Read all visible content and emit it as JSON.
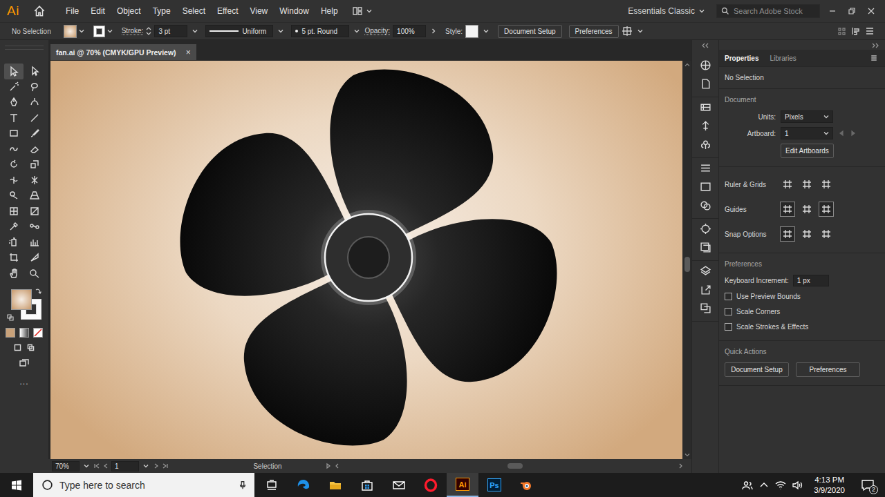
{
  "menu_bar": {
    "logo": "Ai",
    "items": [
      "File",
      "Edit",
      "Object",
      "Type",
      "Select",
      "Effect",
      "View",
      "Window",
      "Help"
    ],
    "workspace": "Essentials Classic",
    "search": {
      "placeholder": "Search Adobe Stock"
    }
  },
  "control_bar": {
    "selection": "No Selection",
    "stroke_label": "Stroke:",
    "stroke_value": "3 pt",
    "profile": "Uniform",
    "brush": "5 pt. Round",
    "opacity_label": "Opacity:",
    "opacity_value": "100%",
    "style_label": "Style:",
    "buttons": [
      "Document Setup",
      "Preferences"
    ]
  },
  "document_tab": {
    "title": "fan.ai @ 70% (CMYK/GPU Preview)",
    "close": "×"
  },
  "toolbar": {
    "tools": [
      {
        "selected": true
      },
      {
        "selected": false
      },
      {
        "selected": false
      },
      {
        "selected": false
      },
      {
        "selected": false
      },
      {
        "selected": false
      },
      {
        "selected": false
      },
      {
        "selected": false
      },
      {
        "selected": false
      },
      {
        "selected": false
      },
      {
        "selected": false
      },
      {
        "selected": false
      },
      {
        "selected": false
      },
      {
        "selected": false
      },
      {
        "selected": false
      },
      {
        "selected": false
      },
      {
        "selected": false
      },
      {
        "selected": false
      },
      {
        "selected": false
      },
      {
        "selected": false
      },
      {
        "selected": false
      },
      {
        "selected": false
      },
      {
        "selected": false
      },
      {
        "selected": false
      },
      {
        "selected": false
      },
      {
        "selected": false
      },
      {
        "selected": false
      },
      {
        "selected": false
      }
    ],
    "more": "..."
  },
  "status_bar": {
    "zoom": "70%",
    "artboard": "1",
    "tool": "Selection"
  },
  "panel": {
    "tabs": [
      {
        "label": "Properties",
        "selected": true
      },
      {
        "label": "Libraries",
        "selected": false
      }
    ],
    "status": "No Selection",
    "document": {
      "heading": "Document",
      "units_label": "Units:",
      "units": "Pixels",
      "artboard_label": "Artboard:",
      "artboard": "1",
      "edit_button": "Edit Artboards"
    },
    "rows": [
      {
        "label": "Ruler & Grids",
        "toggles": [
          false,
          false,
          false
        ]
      },
      {
        "label": "Guides",
        "toggles": [
          true,
          false,
          true
        ]
      },
      {
        "label": "Snap Options",
        "toggles": [
          true,
          false,
          false
        ]
      }
    ],
    "preferences": {
      "heading": "Preferences",
      "increment_label": "Keyboard Increment:",
      "increment": "1 px",
      "checkboxes": [
        {
          "label": "Use Preview Bounds",
          "checked": false
        },
        {
          "label": "Scale Corners",
          "checked": false
        },
        {
          "label": "Scale Strokes & Effects",
          "checked": false
        }
      ]
    },
    "quick_actions": {
      "heading": "Quick Actions",
      "buttons": [
        "Document Setup",
        "Preferences"
      ]
    }
  },
  "taskbar": {
    "search_placeholder": "Type here to search",
    "apps": [
      {
        "kind": "task-view",
        "label": "",
        "active": false
      },
      {
        "kind": "edge",
        "label": "",
        "active": false
      },
      {
        "kind": "explorer",
        "label": "",
        "active": false
      },
      {
        "kind": "store",
        "label": "",
        "active": false
      },
      {
        "kind": "mail",
        "label": "",
        "active": false
      },
      {
        "kind": "opera",
        "label": "",
        "active": false
      },
      {
        "kind": "illustrator",
        "label": "Ai",
        "active": true
      },
      {
        "kind": "photoshop",
        "label": "Ps",
        "active": false
      },
      {
        "kind": "blender",
        "label": "",
        "active": false
      }
    ],
    "time": "4:13 PM",
    "date": "3/9/2020",
    "notifications": "2"
  }
}
